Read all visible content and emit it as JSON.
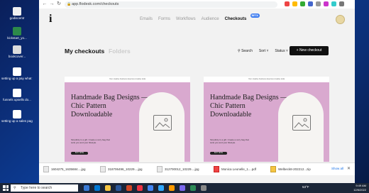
{
  "desktop": {
    "icons": [
      {
        "label": "godiscentr"
      },
      {
        "label": "kickstart_yo..."
      },
      {
        "label": "bookcover..."
      },
      {
        "label": "setting up a pay what y..."
      },
      {
        "label": "funnels upsells do..."
      },
      {
        "label": "setting up a sales page fi..."
      }
    ]
  },
  "browser": {
    "url": "app.flodesk.com/checkouts"
  },
  "app": {
    "menu": [
      "Emails",
      "Forms",
      "Workflows",
      "Audience",
      "Checkouts"
    ],
    "beta": "BETA",
    "page_title": "My checkouts",
    "folders_tab": "Folders",
    "search_label": "Search",
    "sort_label": "Sort",
    "status_label": "Status",
    "new_button": "+ New checkout",
    "cards": [
      {
        "top_text": "Your creative business deserves creative tools",
        "headline": "Handmade Bag Designs — Chic Pattern Downloadable",
        "body": "Simplicity is a gift. Create a cozy bag that suits you and your lifestyle.",
        "cta": "BUY NOW"
      },
      {
        "top_text": "Your creative business deserves creative tools",
        "headline": "Handmade Bag Designs — Chic Pattern Downloadable",
        "body": "Simplicity is a gift. Create a cozy bag that suits you and your lifestyle.",
        "cta": "BUY NOW"
      }
    ]
  },
  "downloads": {
    "items": [
      "1604275_1635684....jpg",
      "318706496_10229....jpg",
      "312700012_10229....jpg",
      "Monica Leonelle_1....pdf",
      "Welbeck8-202212...zip"
    ],
    "show_all": "Show all"
  },
  "taskbar": {
    "search_placeholder": "Type here to search",
    "temperature": "53°F",
    "time": "9:49 AM",
    "date": "12/6/2022"
  },
  "colors": {
    "card_bg": "#d9a9cf",
    "accent_blue": "#3d7cf0",
    "button_dark": "#111111"
  }
}
